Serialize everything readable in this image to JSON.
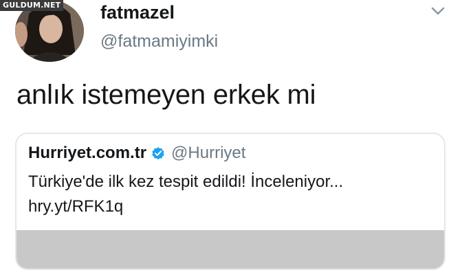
{
  "watermark": {
    "text": "GULDUM.NET"
  },
  "author": {
    "display_name": "fatmazel",
    "handle": "@fatmamiyimki",
    "avatar_icon": "profile-photo"
  },
  "menu": {
    "icon": "chevron-down-icon"
  },
  "tweet": {
    "text": "anlık istemeyen erkek mi"
  },
  "quoted_tweet": {
    "display_name": "Hurriyet.com.tr",
    "verified_icon": "verified-badge-icon",
    "handle": "@Hurriyet",
    "text": "Türkiye'de ilk kez tespit edildi! İnceleniyor...",
    "link": "hry.yt/RFK1q"
  },
  "colors": {
    "primary_text": "#14171a",
    "secondary_text": "#6b7882",
    "border": "#e1e8ed",
    "verified_blue": "#1da1f2",
    "media_placeholder": "#c8c8c8"
  }
}
